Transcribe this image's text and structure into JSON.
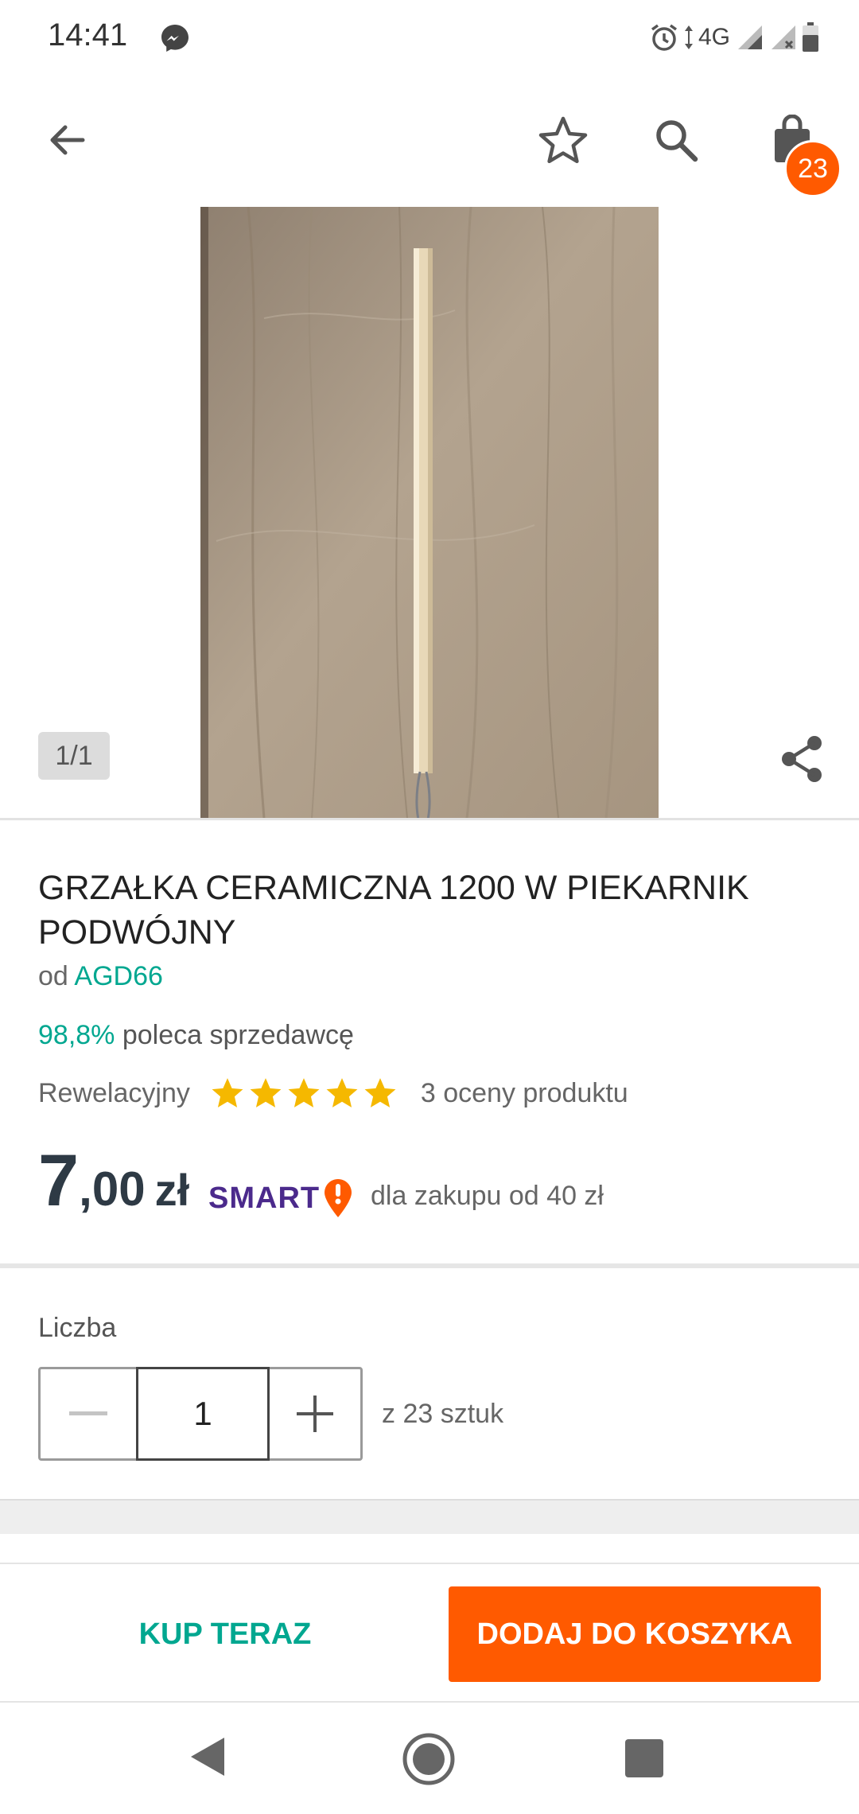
{
  "status_bar": {
    "time": "14:41",
    "network": "4G",
    "icons": [
      "messenger-icon",
      "alarm-icon",
      "signal-icon",
      "signal-no-service-icon",
      "battery-icon"
    ]
  },
  "app_bar": {
    "icons": [
      "arrow-back-icon",
      "star-outline-icon",
      "search-icon",
      "shopping-bag-icon"
    ],
    "cart_count": "23"
  },
  "gallery": {
    "counter": "1/1",
    "share_icon": "share-icon"
  },
  "product": {
    "title": "GRZAŁKA CERAMICZNA 1200 W PIEKARNIK PODWÓJNY",
    "seller_prefix": "od",
    "seller_name": "AGD66",
    "recommend_pct": "98,8%",
    "recommend_text": "poleca sprzedawcę",
    "rating_label": "Rewelacyjny",
    "rating_stars": 5,
    "rating_count_text": "3 oceny produktu",
    "price_int": "7",
    "price_dec": ",00",
    "price_currency": "zł",
    "smart_label": "SMART",
    "smart_note": "dla zakupu od 40 zł"
  },
  "quantity": {
    "label": "Liczba",
    "value": "1",
    "stock_note": "z 23 sztuk"
  },
  "actions": {
    "buy_now": "KUP TERAZ",
    "add_to_cart": "DODAJ DO KOSZYKA"
  },
  "colors": {
    "accent_orange": "#ff5a00",
    "accent_teal": "#00a790",
    "price_text": "#2e3a45",
    "smart_purple": "#4b2a8c",
    "star_yellow": "#f5b800"
  }
}
